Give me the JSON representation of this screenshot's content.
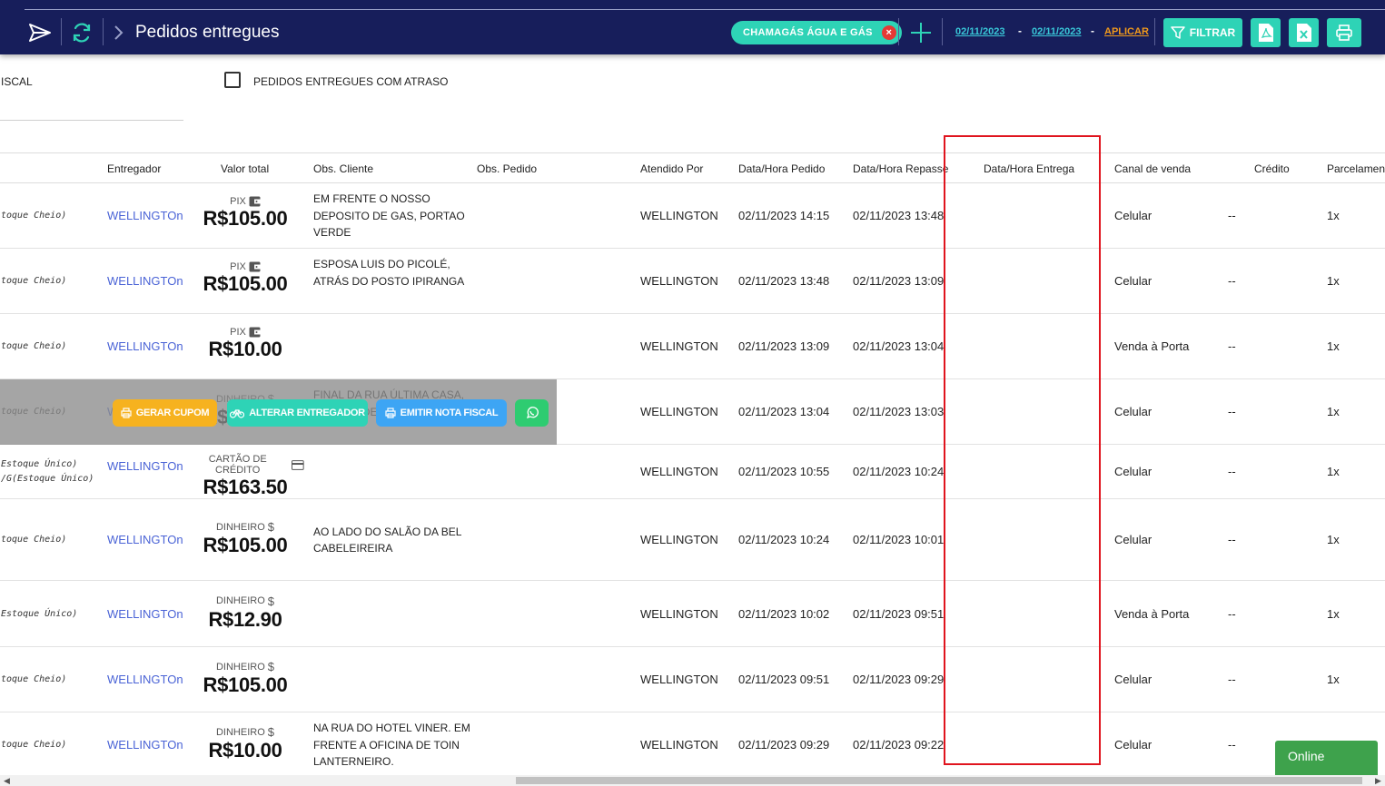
{
  "header": {
    "title": "Pedidos entregues",
    "company_chip": "CHAMAGÁS ÁGUA E GÁS",
    "chip_close": "×",
    "date_from": "02/11/2023",
    "date_to": "02/11/2023",
    "date_sep": "-",
    "date_sep2": "-",
    "apply_label": "APLICAR",
    "filter_label": "FILTRAR"
  },
  "filters": {
    "fiscal_label": "ISCAL",
    "late_orders_label": "PEDIDOS ENTREGUES COM ATRASO"
  },
  "columns": {
    "courier": "Entregador",
    "total": "Valor total",
    "obs_client": "Obs. Cliente",
    "obs_order": "Obs. Pedido",
    "served_by": "Atendido Por",
    "order_time": "Data/Hora Pedido",
    "transfer_time": "Data/Hora Repasse",
    "delivery_time": "Data/Hora Entrega",
    "channel": "Canal de venda",
    "credit": "Crédito",
    "installments": "Parcelamento"
  },
  "rows": [
    {
      "product": "toque Cheio)",
      "product2": "",
      "courier": "WELLINGTOn",
      "pay_type": "PIX",
      "total": "R$105.00",
      "obs": "EM FRENTE O NOSSO DEPOSITO DE GAS, PORTAO VERDE",
      "served_by": "WELLINGTON",
      "order_time": "02/11/2023 14:15",
      "transfer_time": "02/11/2023 13:48",
      "channel": "Celular",
      "credit": "--",
      "installments": "1x"
    },
    {
      "product": "toque Cheio)",
      "product2": "",
      "courier": "WELLINGTOn",
      "pay_type": "PIX",
      "total": "R$105.00",
      "obs": "ESPOSA LUIS DO PICOLÉ, ATRÁS DO POSTO IPIRANGA",
      "served_by": "WELLINGTON",
      "order_time": "02/11/2023 13:48",
      "transfer_time": "02/11/2023 13:09",
      "channel": "Celular",
      "credit": "--",
      "installments": "1x"
    },
    {
      "product": "toque Cheio)",
      "product2": "",
      "courier": "WELLINGTOn",
      "pay_type": "PIX",
      "total": "R$10.00",
      "obs": "",
      "served_by": "WELLINGTON",
      "order_time": "02/11/2023 13:09",
      "transfer_time": "02/11/2023 13:04",
      "channel": "Venda à Porta",
      "credit": "--",
      "installments": "1x"
    },
    {
      "product": "toque Cheio)",
      "product2": "",
      "courier": "WELLINGTOn",
      "pay_type": "DINHEIRO",
      "total": "R$105.00",
      "obs": "FINAL DA RUA ÚLTIMA CASA, PORTÃO DE FERRO VERDE",
      "served_by": "WELLINGTON",
      "order_time": "02/11/2023 13:04",
      "transfer_time": "02/11/2023 13:03",
      "channel": "Celular",
      "credit": "--",
      "installments": "1x"
    },
    {
      "product": "Estoque Único)",
      "product2": "/G(Estoque Único)",
      "courier": "WELLINGTOn",
      "pay_type": "CARTÃO DE CRÉDITO",
      "total": "R$163.50",
      "obs": "",
      "served_by": "WELLINGTON",
      "order_time": "02/11/2023 10:55",
      "transfer_time": "02/11/2023 10:24",
      "channel": "Celular",
      "credit": "--",
      "installments": "1x"
    },
    {
      "product": "toque Cheio)",
      "product2": "",
      "courier": "WELLINGTOn",
      "pay_type": "DINHEIRO",
      "total": "R$105.00",
      "obs": "AO LADO DO SALÃO DA BEL CABELEIREIRA",
      "served_by": "WELLINGTON",
      "order_time": "02/11/2023 10:24",
      "transfer_time": "02/11/2023 10:01",
      "channel": "Celular",
      "credit": "--",
      "installments": "1x"
    },
    {
      "product": "Estoque Único)",
      "product2": "",
      "courier": "WELLINGTOn",
      "pay_type": "DINHEIRO",
      "total": "R$12.90",
      "obs": "",
      "served_by": "WELLINGTON",
      "order_time": "02/11/2023 10:02",
      "transfer_time": "02/11/2023 09:51",
      "channel": "Venda à Porta",
      "credit": "--",
      "installments": "1x"
    },
    {
      "product": "toque Cheio)",
      "product2": "",
      "courier": "WELLINGTOn",
      "pay_type": "DINHEIRO",
      "total": "R$105.00",
      "obs": "",
      "served_by": "WELLINGTON",
      "order_time": "02/11/2023 09:51",
      "transfer_time": "02/11/2023 09:29",
      "channel": "Celular",
      "credit": "--",
      "installments": "1x"
    },
    {
      "product": "toque Cheio)",
      "product2": "",
      "courier": "WELLINGTOn",
      "pay_type": "DINHEIRO",
      "total": "R$10.00",
      "obs": "NA RUA DO HOTEL VINER. EM FRENTE A OFICINA DE TOIN LANTERNEIRO.",
      "served_by": "WELLINGTON",
      "order_time": "02/11/2023 09:29",
      "transfer_time": "02/11/2023 09:22",
      "channel": "Celular",
      "credit": "--",
      "installments": ""
    }
  ],
  "hover_actions": {
    "coupon": "GERAR CUPOM",
    "change_courier": "ALTERAR ENTREGADOR",
    "invoice": "EMITIR NOTA FISCAL"
  },
  "chat": {
    "status": "Online"
  },
  "colors": {
    "topbar": "#171e5b",
    "accent": "#2ed3b6",
    "link": "#4a63d6",
    "highlight": "#e0141e",
    "coupon": "#f6b21f",
    "invoice": "#3da5f4",
    "whatsapp": "#2ecc71"
  }
}
